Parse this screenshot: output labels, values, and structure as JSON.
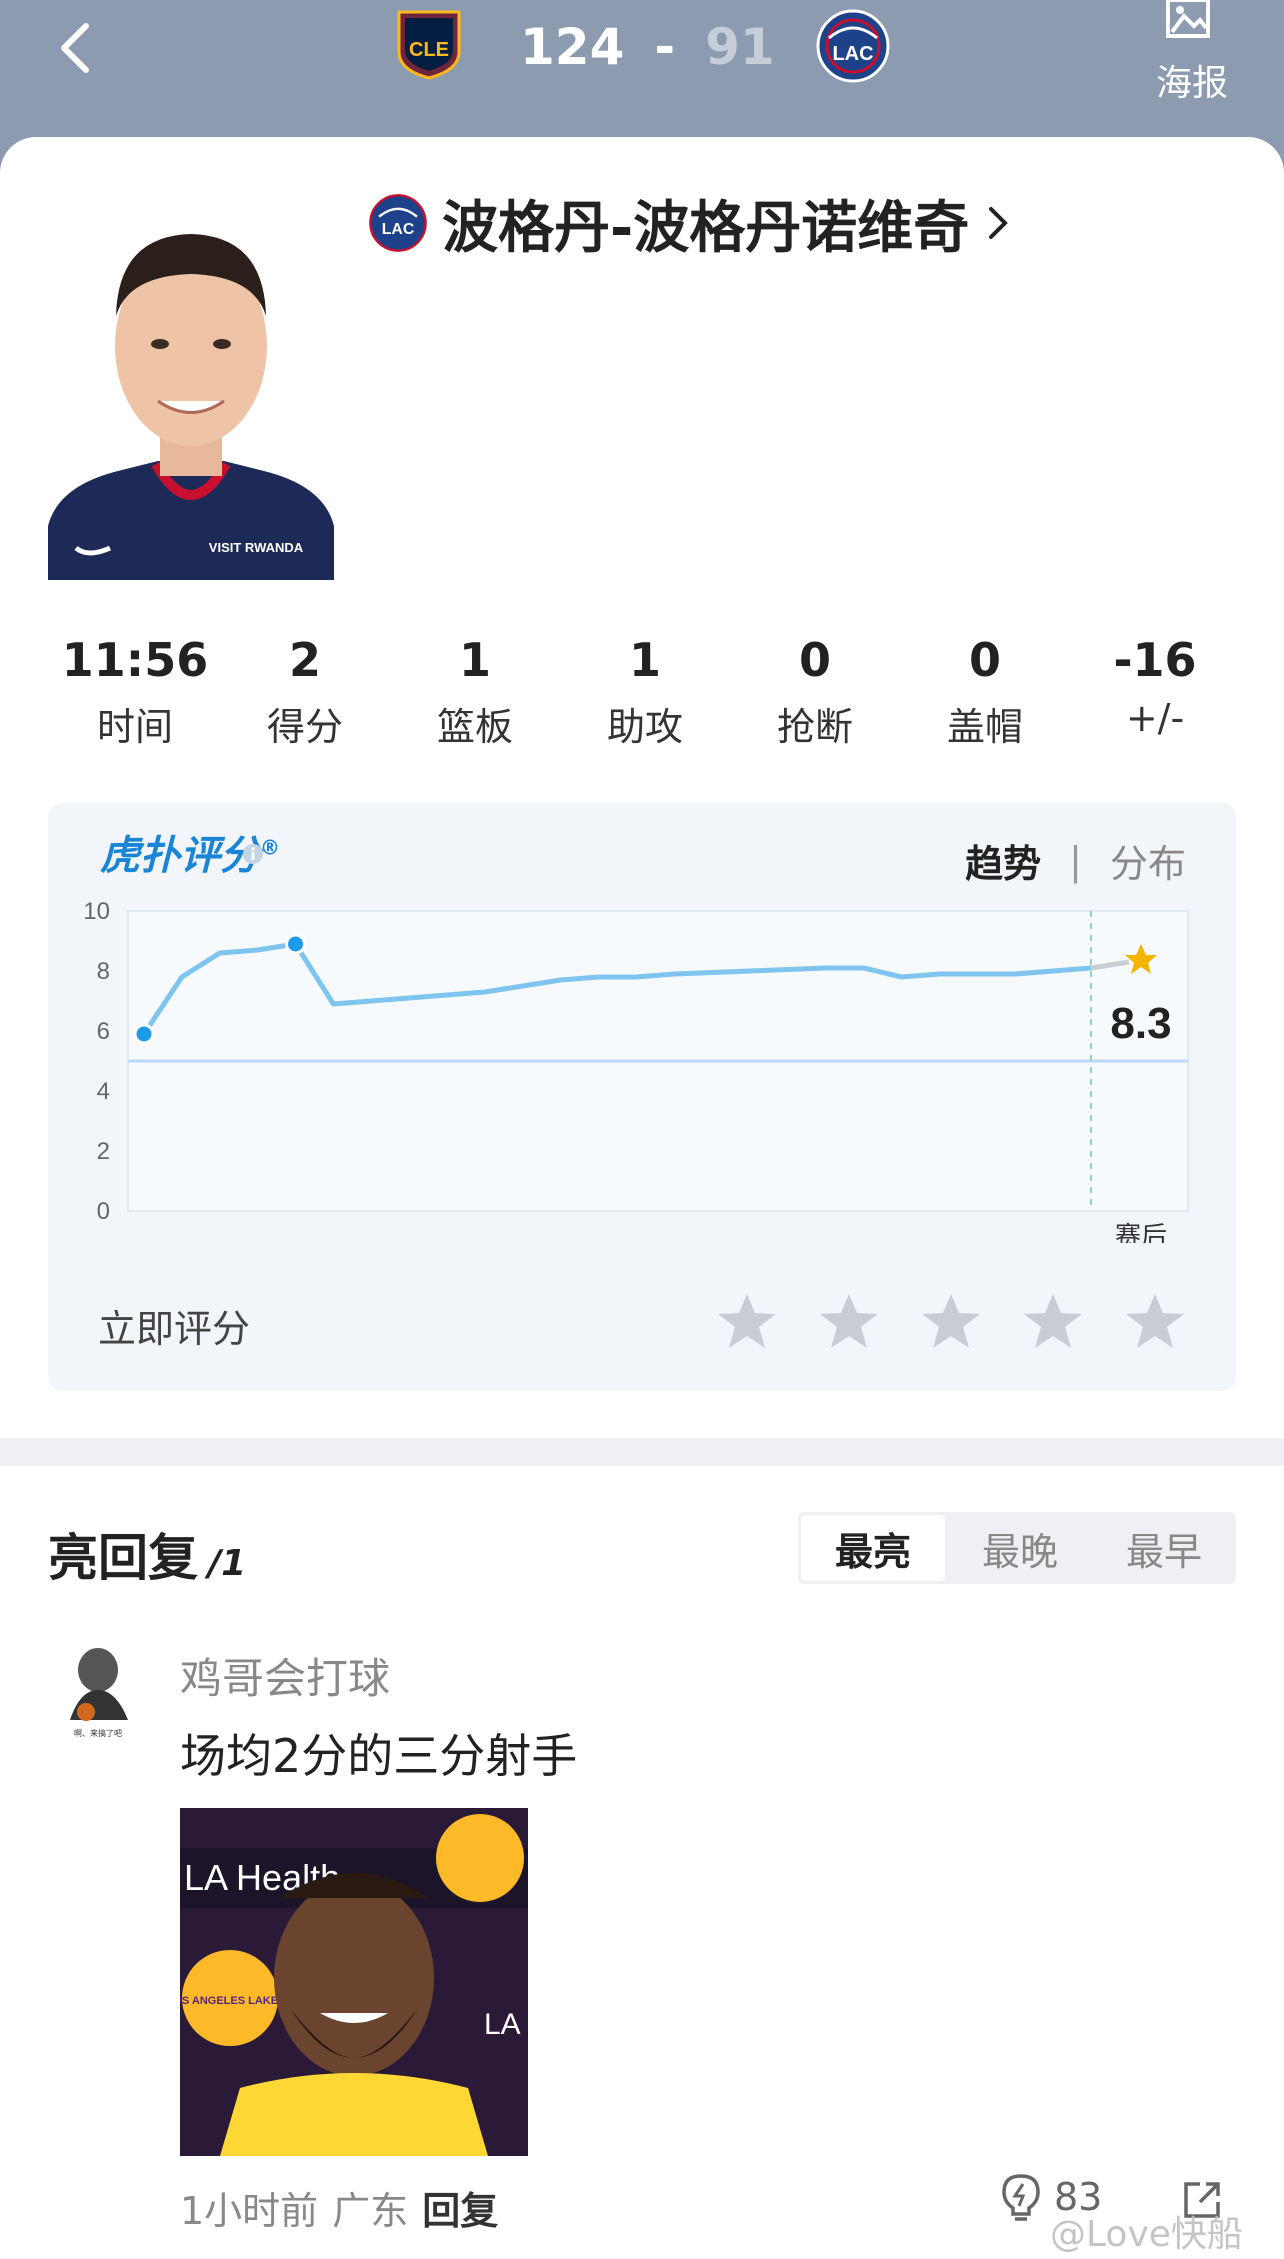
{
  "header": {
    "home_team_abbr": "CLE",
    "away_team_abbr": "LAC",
    "home_score": "124",
    "separator": "-",
    "away_score": "91",
    "poster_label": "海报"
  },
  "player": {
    "name": "波格丹-波格丹诺维奇",
    "team_abbr": "LAC",
    "jersey_text": "VISIT RWANDA"
  },
  "stats": [
    {
      "value": "11:56",
      "label": "时间"
    },
    {
      "value": "2",
      "label": "得分"
    },
    {
      "value": "1",
      "label": "篮板"
    },
    {
      "value": "1",
      "label": "助攻"
    },
    {
      "value": "0",
      "label": "抢断"
    },
    {
      "value": "0",
      "label": "盖帽"
    },
    {
      "value": "-16",
      "label": "+/-"
    }
  ],
  "rating": {
    "brand": "虎扑评分",
    "brand_mark": "®",
    "tab_trend": "趋势",
    "tab_sep": "|",
    "tab_dist": "分布",
    "rate_now_label": "立即评分",
    "star_count": 5,
    "accent_color": "#1a85d6"
  },
  "chart_data": {
    "type": "line",
    "title": "",
    "xlabel": "",
    "ylabel": "",
    "ylim": [
      0,
      10
    ],
    "yticks": [
      "10",
      "8",
      "6",
      "4",
      "2",
      "0"
    ],
    "x_end_label": "赛后",
    "final_value": "8.3",
    "series": [
      {
        "values": [
          5.9,
          7.8,
          8.6,
          8.7,
          8.9,
          6.9,
          7.0,
          7.1,
          7.2,
          7.3,
          7.5,
          7.7,
          7.8,
          7.8,
          7.9,
          7.95,
          8.0,
          8.05,
          8.1,
          8.1,
          7.8,
          7.9,
          7.9,
          7.9,
          8.0,
          8.1
        ]
      }
    ],
    "reference_line": 5.0
  },
  "replies": {
    "title": "亮回复",
    "count": "/1",
    "sort_tabs": [
      "最亮",
      "最晚",
      "最早"
    ],
    "active_sort": "最亮",
    "items": [
      {
        "user": "鸡哥会打球",
        "avatar_caption": "啊、来搞了吧",
        "text": "场均2分的三分射手",
        "image_texts": [
          "LA Health",
          "LOS ANGELES LAKERS",
          "LA He"
        ],
        "time": "1小时前",
        "location": "广东",
        "reply_label": "回复",
        "likes": "83"
      }
    ]
  },
  "watermark": "@Love快船"
}
